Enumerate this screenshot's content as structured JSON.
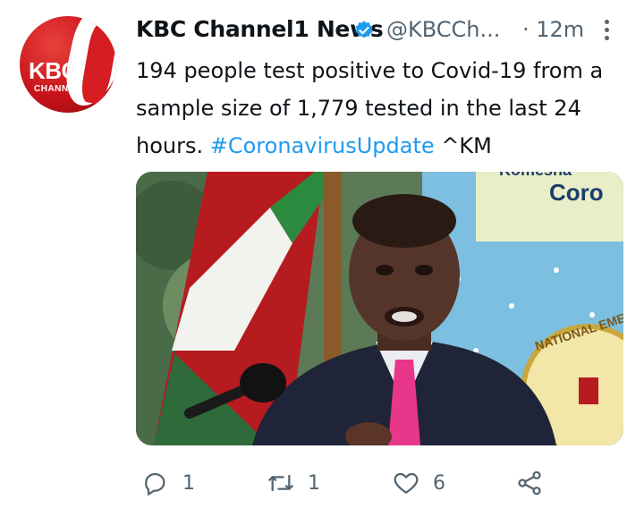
{
  "tweet": {
    "author_name": "KBC Channel1 News",
    "author_handle": "@KBCCh...",
    "timestamp": "· 12m",
    "avatar": {
      "logo_text": "KBC",
      "logo_subtext": "CHANNEL"
    },
    "body_text": "194 people test positive to Covid-19 from a sample size of 1,779 tested in the last 24 hours.",
    "hashtag": "#CoronavirusUpdate",
    "signature": "^KM",
    "media": {
      "banner_text_top": "Komesha",
      "banner_text": "Coro",
      "seal_text": "NATIONAL EME"
    },
    "actions": {
      "reply_count": "1",
      "retweet_count": "1",
      "like_count": "6"
    }
  },
  "colors": {
    "link": "#1d9bf0",
    "secondary_text": "#536471",
    "verified": "#1d9bf0",
    "brand_red": "#c8121a"
  },
  "icons": [
    "verified-badge-icon",
    "more-options-icon",
    "reply-icon",
    "retweet-icon",
    "like-icon",
    "share-icon"
  ]
}
